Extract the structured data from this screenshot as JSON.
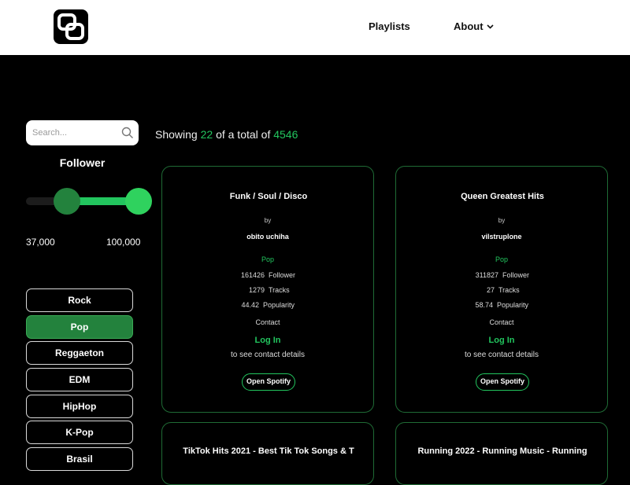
{
  "nav": {
    "logo_icon": "app-logo-icon",
    "items": [
      {
        "label": "Playlists"
      },
      {
        "label": "About",
        "icon": "chevron-down-icon"
      }
    ]
  },
  "sidebar": {
    "search_placeholder": "Search...",
    "search_icon": "search-icon",
    "follower_title": "Follower",
    "slider": {
      "min_value": 37000,
      "max_value": 100000,
      "min_label": "37,000",
      "max_label": "100,000"
    },
    "genres": [
      {
        "label": "Rock",
        "active": false
      },
      {
        "label": "Pop",
        "active": true
      },
      {
        "label": "Reggaeton",
        "active": false
      },
      {
        "label": "EDM",
        "active": false
      },
      {
        "label": "HipHop",
        "active": false
      },
      {
        "label": "K-Pop",
        "active": false
      },
      {
        "label": "Brasil",
        "active": false
      }
    ]
  },
  "results": {
    "prefix": "Showing",
    "shown": "22",
    "middle": "of a total of",
    "total": "4546"
  },
  "cards": [
    {
      "title": "Funk / Soul / Disco",
      "by": "by",
      "user": "obito uchiha",
      "genre": "Pop",
      "followers": "161426",
      "followers_label": "Follower",
      "tracks": "1279",
      "tracks_label": "Tracks",
      "popularity": "44.42",
      "popularity_label": "Popularity",
      "contact": "Contact",
      "login": "Log In",
      "login_sub": "to see contact details",
      "spotify": "Open Spotify"
    },
    {
      "title": "Queen Greatest Hits",
      "by": "by",
      "user": "vilstruplone",
      "genre": "Pop",
      "followers": "311827",
      "followers_label": "Follower",
      "tracks": "27",
      "tracks_label": "Tracks",
      "popularity": "58.74",
      "popularity_label": "Popularity",
      "contact": "Contact",
      "login": "Log In",
      "login_sub": "to see contact details",
      "spotify": "Open Spotify"
    },
    {
      "title": "TikTok Hits 2021 - Best Tik Tok Songs & T"
    },
    {
      "title": "Running 2022 - Running Music - Running"
    }
  ],
  "colors": {
    "accent": "#22c55e",
    "active_genre": "#23823d",
    "card_border": "#1f6b35"
  }
}
